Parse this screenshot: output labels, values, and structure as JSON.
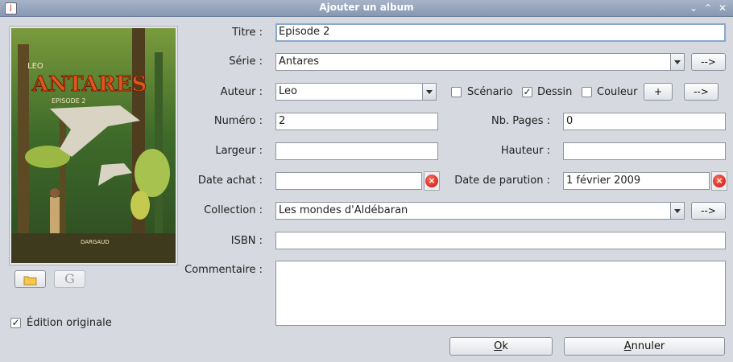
{
  "window": {
    "title": "Ajouter un album"
  },
  "labels": {
    "titre": "Titre :",
    "serie": "Série :",
    "auteur": "Auteur :",
    "numero": "Numéro :",
    "largeur": "Largeur :",
    "date_achat": "Date achat :",
    "collection": "Collection :",
    "isbn": "ISBN :",
    "commentaire": "Commentaire :",
    "nb_pages": "Nb. Pages :",
    "hauteur": "Hauteur :",
    "date_parution": "Date de parution :"
  },
  "fields": {
    "titre": "Episode 2",
    "serie": "Antares",
    "auteur": "Leo",
    "numero": "2",
    "nb_pages": "0",
    "largeur": "",
    "hauteur": "",
    "date_achat": "",
    "date_parution": "1 février 2009",
    "collection": "Les mondes d'Aldébaran",
    "isbn": "",
    "commentaire": ""
  },
  "roles": {
    "scenario": {
      "label": "Scénario",
      "checked": false
    },
    "dessin": {
      "label": "Dessin",
      "checked": true
    },
    "couleur": {
      "label": "Couleur",
      "checked": false
    }
  },
  "buttons": {
    "serie_go": "-->",
    "auteur_add": "+",
    "auteur_go": "-->",
    "collection_go": "-->",
    "google": "G",
    "ok_prefix": "O",
    "ok_rest": "k",
    "annuler_prefix": "A",
    "annuler_rest": "nnuler"
  },
  "edition_originale": {
    "label": "Édition originale",
    "checked": true
  },
  "cover": {
    "author": "LEO",
    "series": "ANTARES",
    "episode": "EPISODE 2",
    "publisher": "DARGAUD"
  },
  "icons": {
    "check": "✓",
    "clear": "×",
    "app": "J",
    "minimize": "⌄",
    "maximize": "⌃",
    "close": "✕"
  }
}
